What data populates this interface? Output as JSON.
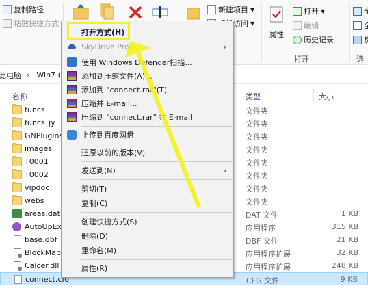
{
  "ribbon": {
    "copy_path": "复制路径",
    "paste_shortcut": "粘贴快捷方式",
    "new_item": "新建项目",
    "easy_access": "轻松访问",
    "properties": "属性",
    "open": "打开",
    "edit": "编辑",
    "history": "历史记录",
    "open_group": "打开",
    "select_all": "全部",
    "select_none": "全部",
    "invert": "反向",
    "select_group": "选项"
  },
  "address": {
    "root": "此电脑",
    "folder": "Win7 (C"
  },
  "columns": {
    "name": "名称",
    "type": "类型",
    "size": "大小"
  },
  "files": [
    {
      "name": "funcs",
      "type": "文件夹",
      "size": "",
      "icon": "folder-icon"
    },
    {
      "name": "funcs_jy",
      "type": "文件夹",
      "size": "",
      "icon": "folder-icon"
    },
    {
      "name": "GNPlugins",
      "type": "文件夹",
      "size": "",
      "icon": "folder-icon"
    },
    {
      "name": "images",
      "type": "文件夹",
      "size": "",
      "icon": "folder-icon"
    },
    {
      "name": "T0001",
      "type": "文件夹",
      "size": "",
      "icon": "folder-icon"
    },
    {
      "name": "T0002",
      "type": "文件夹",
      "size": "",
      "icon": "folder-icon"
    },
    {
      "name": "vipdoc",
      "type": "文件夹",
      "size": "",
      "icon": "folder-icon"
    },
    {
      "name": "webs",
      "type": "文件夹",
      "size": "",
      "icon": "folder-icon"
    },
    {
      "name": "areas.dat",
      "type": "DAT 文件",
      "size": "1 KB",
      "icon": "dat-file-icon"
    },
    {
      "name": "AutoUpEx",
      "type": "应用程序",
      "size": "315 KB",
      "icon": "app-icon"
    },
    {
      "name": "base.dbf",
      "type": "DBF 文件",
      "size": "21 KB",
      "icon": "file-icon"
    },
    {
      "name": "BlockMap",
      "type": "应用程序扩展",
      "size": "32 KB",
      "icon": "dll-icon"
    },
    {
      "name": "Calcer.dll",
      "type": "应用程序扩展",
      "size": "248 KB",
      "icon": "dll-icon"
    },
    {
      "name": "connect.cfg",
      "type": "CFG 文件",
      "size": "9 KB",
      "icon": "file-icon"
    }
  ],
  "context_menu": {
    "open_with": "打开方式(H)",
    "skydrive": "SkyDrive Pro(S)",
    "defender": "使用 Windows Defender扫描...",
    "add_archive": "添加到压缩文件(A)...",
    "add_rar": "添加到 \"connect.rar\"(T)",
    "compress_email": "压缩并 E-mail...",
    "compress_rar_email": "压缩到 \"connect.rar\" 并 E-mail",
    "baidu": "上传到百度网盘",
    "restore": "还原以前的版本(V)",
    "send_to": "发送到(N)",
    "cut": "剪切(T)",
    "copy": "复制(C)",
    "create_shortcut": "创建快捷方式(S)",
    "delete": "删除(D)",
    "rename": "重命名(M)",
    "props": "属性(R)"
  },
  "colors": {
    "highlight": "#f7f21a",
    "selection": "#cce8ff"
  }
}
